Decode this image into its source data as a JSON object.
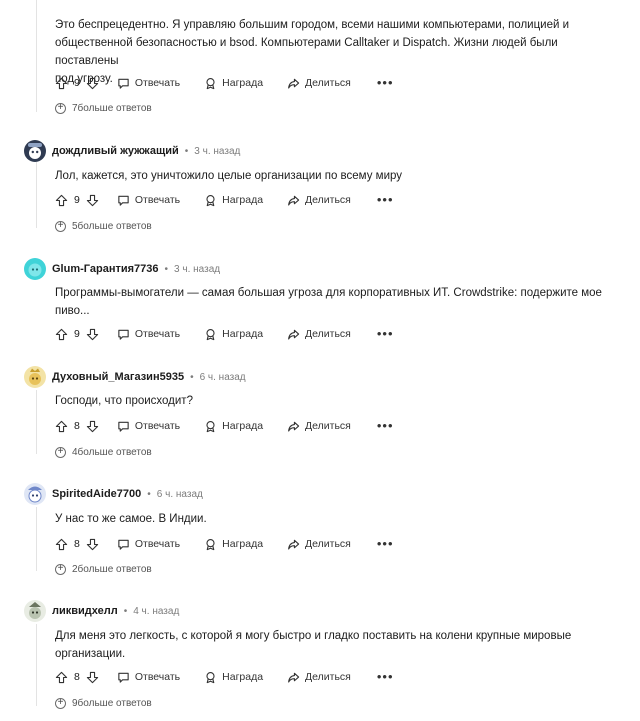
{
  "actions": {
    "reply": "Отвечать",
    "award": "Награда",
    "share": "Делиться"
  },
  "comments": [
    {
      "author": "",
      "time": "",
      "body": [
        "Это беспрецедентно. Я управляю большим городом, всеми нашими компьютерами, полицией и",
        "общественной безопасностью и bsod. Компьютерами Calltaker и Dispatch. Жизни людей были поставлены",
        "под угрозу."
      ],
      "votes": "9",
      "replies": "7больше ответов",
      "avatar_color": "#7a8fb5"
    },
    {
      "author": "дождливый жужжащий",
      "time": "3 ч. назад",
      "body": [
        "Лол, кажется, это уничтожило целые организации по всему миру"
      ],
      "votes": "9",
      "replies": "5больше ответов",
      "avatar_color": "#2f3b52"
    },
    {
      "author": "Glum-Гарантия7736",
      "time": "3 ч. назад",
      "body": [
        "Программы-вымогатели — самая большая угроза для корпоративных ИТ. Crowdstrike: подержите мое",
        "пиво..."
      ],
      "votes": "9",
      "replies": "",
      "avatar_color": "#3fd3d8"
    },
    {
      "author": "Духовный_Магазин5935",
      "time": "6 ч. назад",
      "body": [
        "Господи, что происходит?"
      ],
      "votes": "8",
      "replies": "4больше ответов",
      "avatar_color": "#e8c25a"
    },
    {
      "author": "SpiritedAide7700",
      "time": "6 ч. назад",
      "body": [
        "У нас то же самое. В Индии."
      ],
      "votes": "8",
      "replies": "2больше ответов",
      "avatar_color": "#6f87c9"
    },
    {
      "author": "ликвидхелл",
      "time": "4 ч. назад",
      "body": [
        "Для меня это легкость, с которой я могу быстро и гладко поставить на колени крупные мировые",
        "организации."
      ],
      "votes": "8",
      "replies": "9больше ответов",
      "avatar_color": "#b9c3b0"
    }
  ]
}
